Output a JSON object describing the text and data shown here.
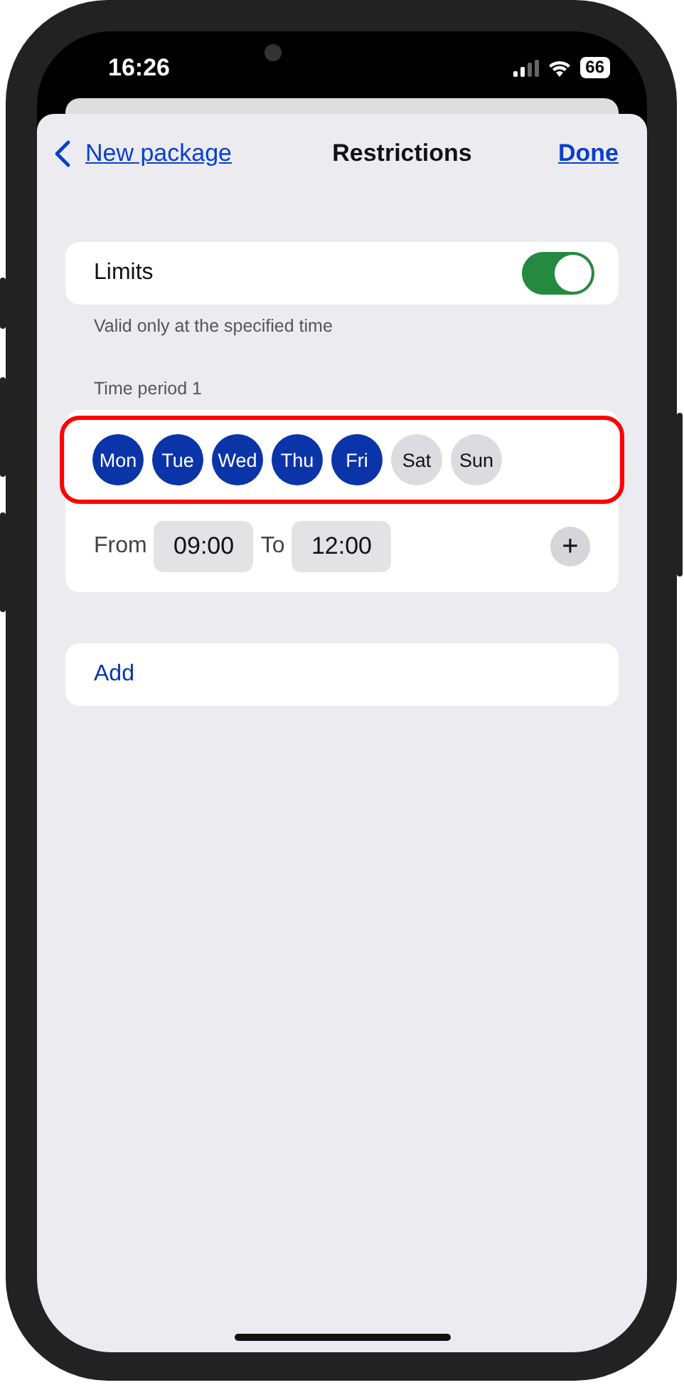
{
  "status_bar": {
    "time": "16:26",
    "battery": "66"
  },
  "nav": {
    "back": "New package",
    "title": "Restrictions",
    "done": "Done"
  },
  "limits": {
    "label": "Limits",
    "on": true,
    "caption": "Valid only at the specified time"
  },
  "time_period": {
    "title": "Time period 1",
    "highlighted": true,
    "days": [
      {
        "label": "Mon",
        "selected": true
      },
      {
        "label": "Tue",
        "selected": true
      },
      {
        "label": "Wed",
        "selected": true
      },
      {
        "label": "Thu",
        "selected": true
      },
      {
        "label": "Fri",
        "selected": true
      },
      {
        "label": "Sat",
        "selected": false
      },
      {
        "label": "Sun",
        "selected": false
      }
    ],
    "from_label": "From",
    "from": "09:00",
    "to_label": "To",
    "to": "12:00",
    "add_symbol": "+"
  },
  "add": "Add"
}
